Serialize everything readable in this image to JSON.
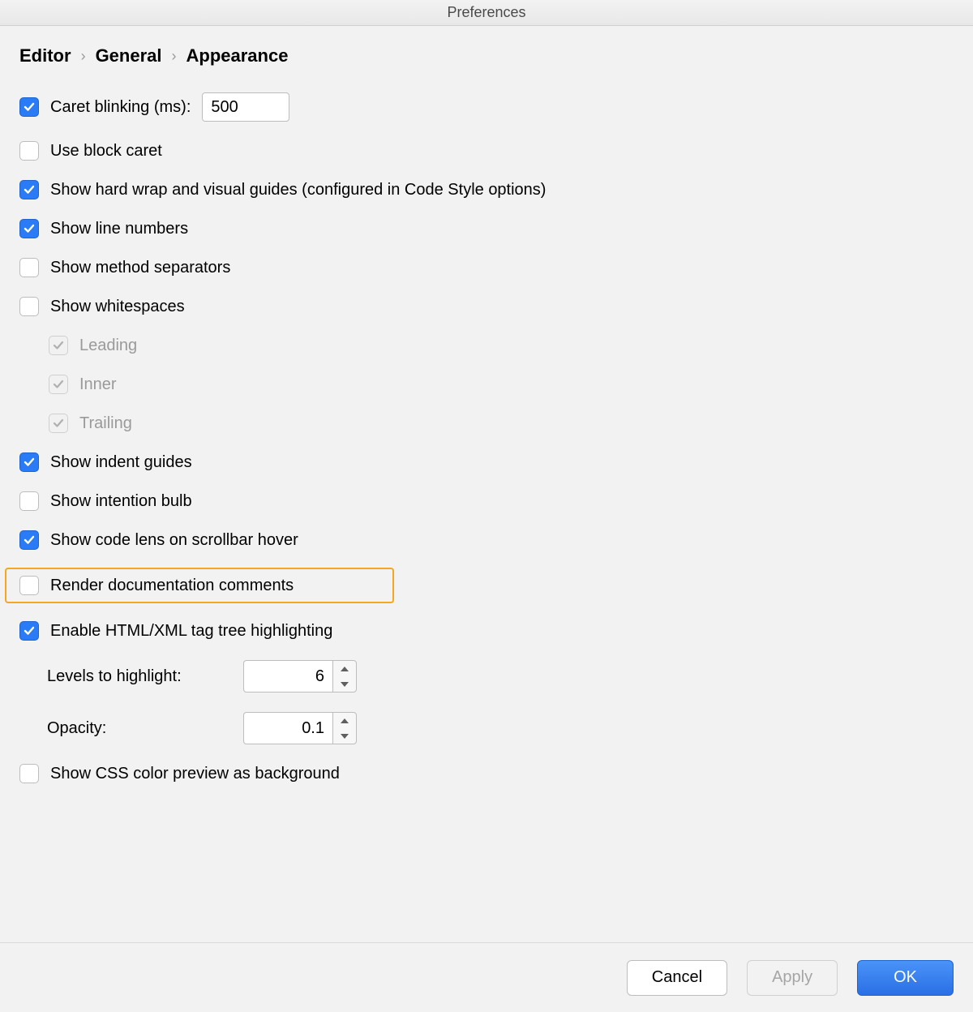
{
  "window": {
    "title": "Preferences"
  },
  "breadcrumb": [
    "Editor",
    "General",
    "Appearance"
  ],
  "options": {
    "caret_blinking": {
      "label": "Caret blinking (ms):",
      "value": "500",
      "checked": true
    },
    "block_caret": {
      "label": "Use block caret",
      "checked": false
    },
    "hard_wrap": {
      "label": "Show hard wrap and visual guides (configured in Code Style options)",
      "checked": true
    },
    "line_numbers": {
      "label": "Show line numbers",
      "checked": true
    },
    "method_sep": {
      "label": "Show method separators",
      "checked": false
    },
    "whitespaces": {
      "label": "Show whitespaces",
      "checked": false,
      "leading": {
        "label": "Leading",
        "checked": true
      },
      "inner": {
        "label": "Inner",
        "checked": true
      },
      "trailing": {
        "label": "Trailing",
        "checked": true
      }
    },
    "indent_guides": {
      "label": "Show indent guides",
      "checked": true
    },
    "intention_bulb": {
      "label": "Show intention bulb",
      "checked": false
    },
    "code_lens": {
      "label": "Show code lens on scrollbar hover",
      "checked": true
    },
    "render_doc": {
      "label": "Render documentation comments",
      "checked": false
    },
    "html_tag_tree": {
      "label": "Enable HTML/XML tag tree highlighting",
      "checked": true,
      "levels": {
        "label": "Levels to highlight:",
        "value": "6"
      },
      "opacity": {
        "label": "Opacity:",
        "value": "0.1"
      }
    },
    "css_preview": {
      "label": "Show CSS color preview as background",
      "checked": false
    }
  },
  "buttons": {
    "cancel": "Cancel",
    "apply": "Apply",
    "ok": "OK"
  }
}
